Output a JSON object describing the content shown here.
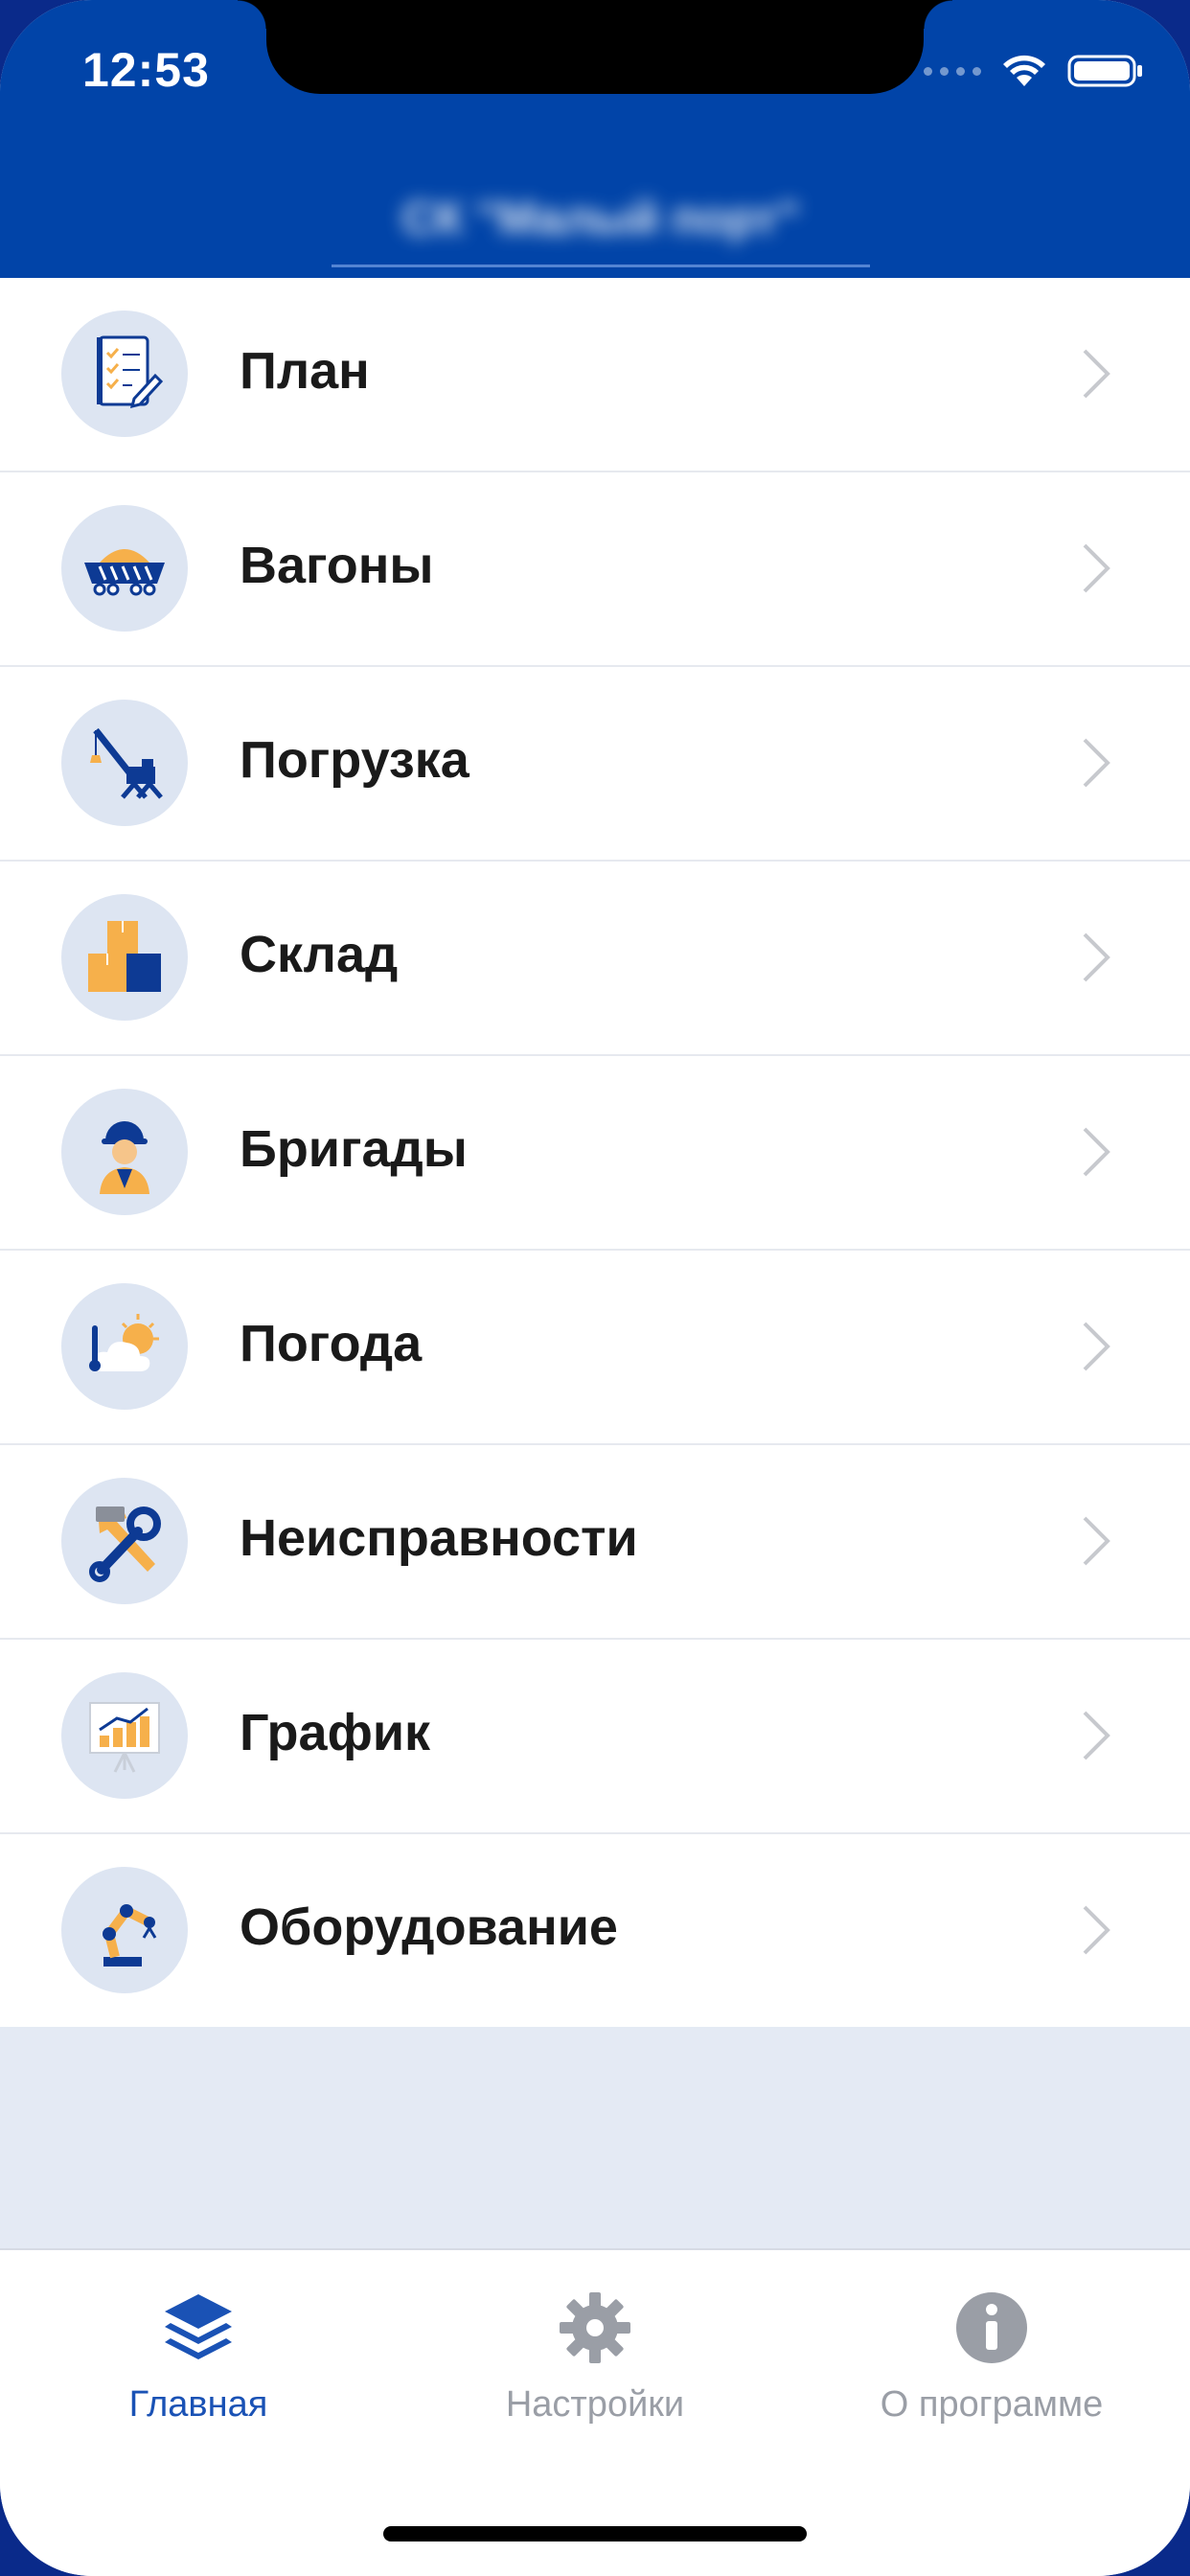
{
  "status_bar": {
    "time": "12:53"
  },
  "header": {
    "title": "СК \"Малый порт\""
  },
  "menu": {
    "items": [
      {
        "label": "План",
        "icon": "plan-checklist-icon"
      },
      {
        "label": "Вагоны",
        "icon": "wagon-icon"
      },
      {
        "label": "Погрузка",
        "icon": "crane-icon"
      },
      {
        "label": "Склад",
        "icon": "warehouse-boxes-icon"
      },
      {
        "label": "Бригады",
        "icon": "worker-icon"
      },
      {
        "label": "Погода",
        "icon": "weather-icon"
      },
      {
        "label": "Неисправности",
        "icon": "tools-icon"
      },
      {
        "label": "График",
        "icon": "chart-board-icon"
      },
      {
        "label": "Оборудование",
        "icon": "robot-arm-icon"
      }
    ]
  },
  "tabbar": {
    "tabs": [
      {
        "label": "Главная",
        "icon": "layers-icon",
        "active": true
      },
      {
        "label": "Настройки",
        "icon": "gear-icon",
        "active": false
      },
      {
        "label": "О программе",
        "icon": "info-icon",
        "active": false
      }
    ]
  },
  "colors": {
    "header_blue": "#0144a8",
    "accent_blue": "#1a52b5",
    "icon_orange": "#f6b04b",
    "icon_navy": "#0d3a94",
    "inactive_gray": "#9a9ea6"
  }
}
